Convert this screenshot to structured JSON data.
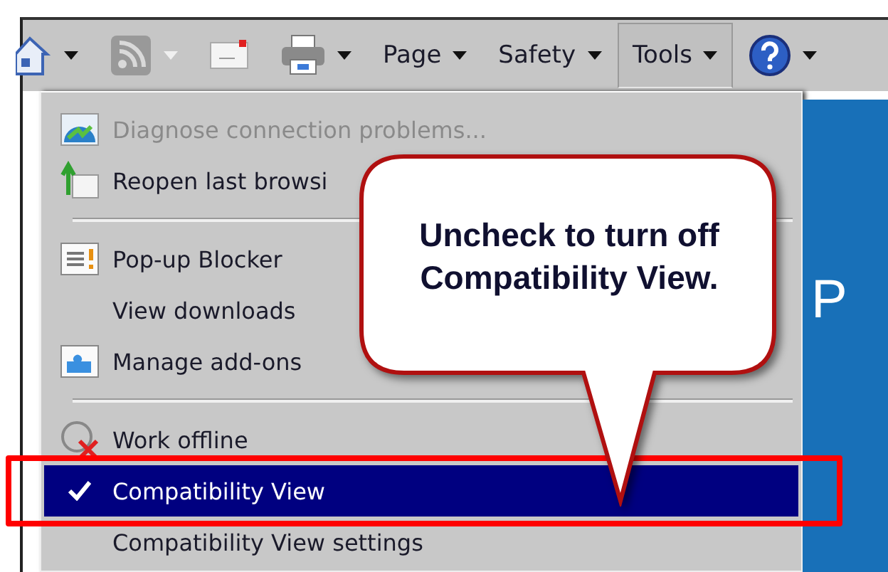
{
  "toolbar": [
    {
      "kind": "icon",
      "dropdown": true,
      "disabled": false,
      "selected": false
    },
    {
      "kind": "icon",
      "dropdown": true,
      "disabled": true,
      "selected": false
    },
    {
      "kind": "icon",
      "dropdown": false,
      "disabled": false,
      "selected": false
    },
    {
      "kind": "icon",
      "dropdown": true,
      "disabled": false,
      "selected": false
    },
    {
      "kind": "text",
      "label": "Page",
      "dropdown": true,
      "disabled": false,
      "selected": false
    },
    {
      "kind": "text",
      "label": "Safety",
      "dropdown": true,
      "disabled": false,
      "selected": false
    },
    {
      "kind": "text",
      "label": "Tools",
      "dropdown": true,
      "disabled": false,
      "selected": true
    },
    {
      "kind": "icon",
      "dropdown": true,
      "disabled": false,
      "selected": false
    }
  ],
  "menu": [
    {
      "kind": "item",
      "label": "Diagnose connection problems...",
      "disabled": true,
      "checked": false,
      "selected": false
    },
    {
      "kind": "item",
      "label": "Reopen last browsi",
      "disabled": false,
      "checked": false,
      "selected": false
    },
    {
      "kind": "separator"
    },
    {
      "kind": "item",
      "label": "Pop-up Blocker",
      "disabled": false,
      "checked": false,
      "selected": false
    },
    {
      "kind": "item",
      "label": "View downloads",
      "disabled": false,
      "checked": false,
      "selected": false
    },
    {
      "kind": "item",
      "label": "Manage add-ons",
      "disabled": false,
      "checked": false,
      "selected": false
    },
    {
      "kind": "separator"
    },
    {
      "kind": "item",
      "label": "Work offline",
      "disabled": false,
      "checked": false,
      "selected": false
    },
    {
      "kind": "item",
      "label": "Compatibility View",
      "disabled": false,
      "checked": true,
      "selected": true
    },
    {
      "kind": "item",
      "label": "Compatibility View settings",
      "disabled": false,
      "checked": false,
      "selected": false
    }
  ],
  "page_text": "P",
  "callout": {
    "text": "Uncheck to turn off Compatibility View."
  }
}
